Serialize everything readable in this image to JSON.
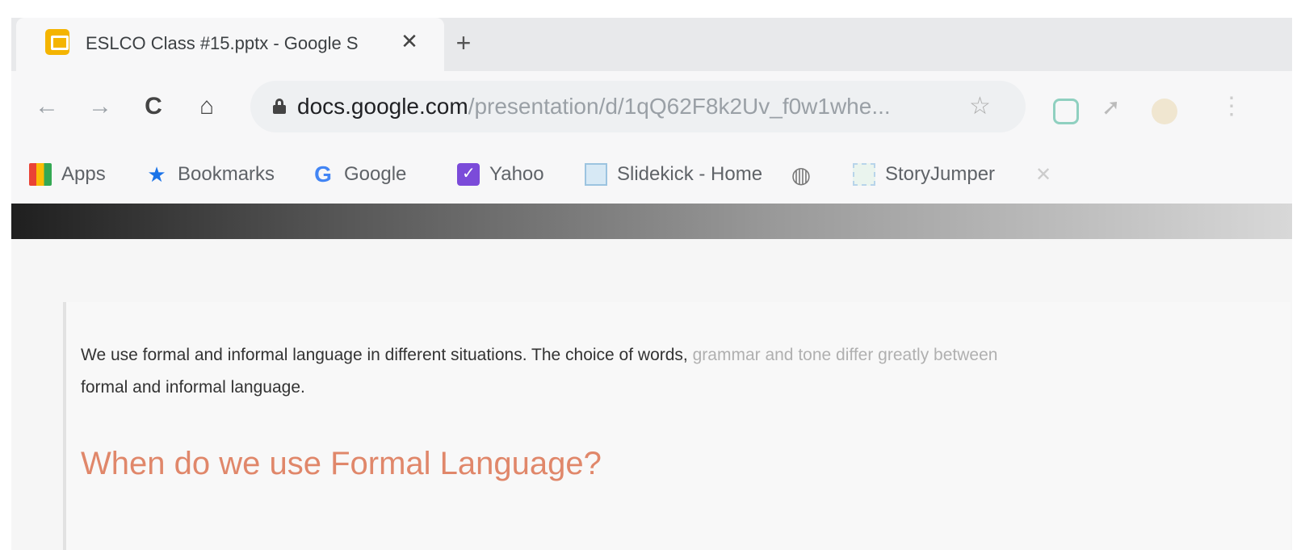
{
  "tab": {
    "title": "ESLCO Class #15.pptx - Google S",
    "close": "✕",
    "new_tab": "+"
  },
  "toolbar": {
    "back": "←",
    "forward": "→",
    "reload": "C",
    "home": "⌂",
    "url_host": "docs.google.com",
    "url_path": "/presentation/d/1qQ62F8k2Uv_f0w1whe...",
    "star": "☆",
    "menu": "⋮"
  },
  "bookmarks": [
    {
      "label": "Apps",
      "icon": "apps-icon"
    },
    {
      "label": "Bookmarks",
      "icon": "star-icon"
    },
    {
      "label": "Google",
      "icon": "google-icon"
    },
    {
      "label": "Yahoo",
      "icon": "yahoo-icon"
    },
    {
      "label": "Slidekick - Home",
      "icon": "slides-icon"
    },
    {
      "label": "",
      "icon": "globe-icon"
    },
    {
      "label": "StoryJumper",
      "icon": "storyjumper-icon"
    }
  ],
  "bookmark_close": "✕",
  "slide": {
    "body_dark": "We use formal and informal language in different situations. The choice of words,",
    "body_faded": " grammar and tone differ greatly between",
    "body_line2": "formal and informal language.",
    "heading": "When do we use Formal Language?"
  },
  "colors": {
    "heading": "#e0876a",
    "favicon": "#f4b400"
  }
}
